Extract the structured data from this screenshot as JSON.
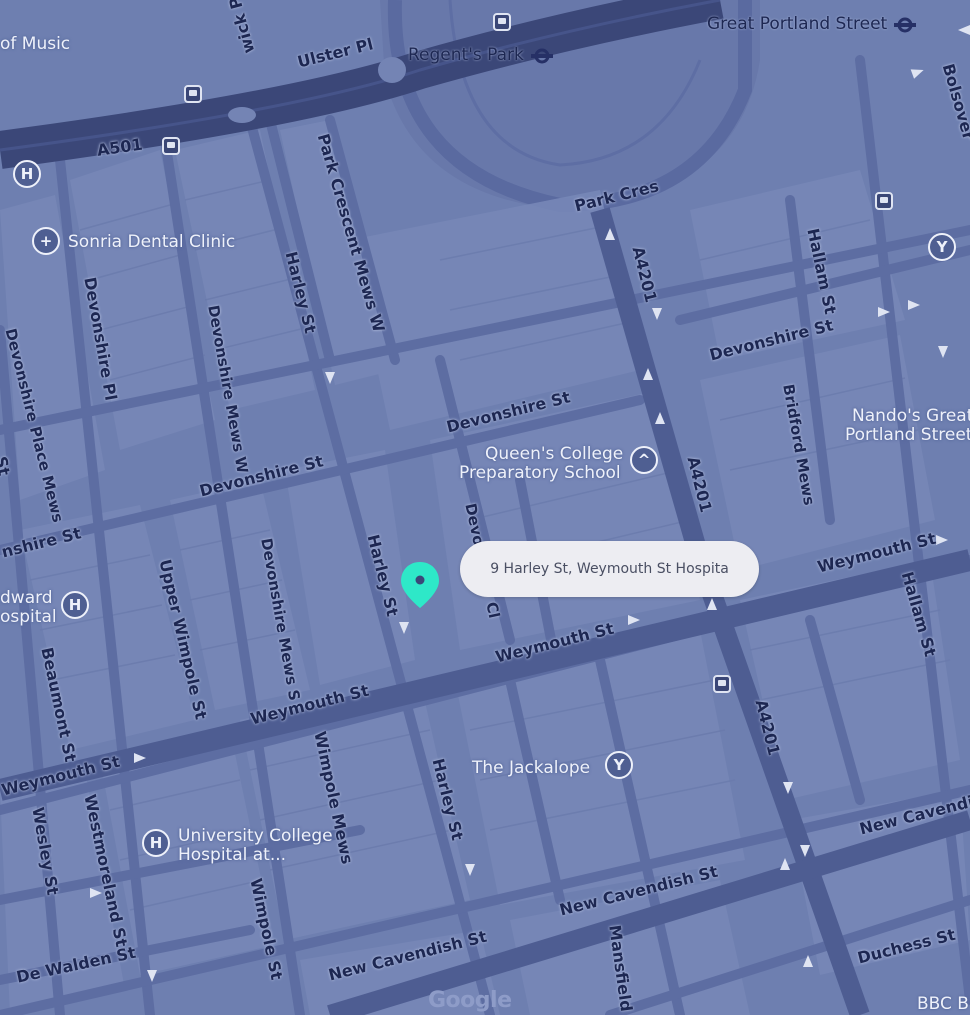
{
  "map": {
    "colors": {
      "background": "#6e7fb0",
      "block": "#7686b6",
      "road": "#5a6aa0",
      "major_road": "#4e5d92",
      "arterial": "#3b4778",
      "marker": "#2ee8c8",
      "callout_bg": "#ededf2"
    },
    "callout": {
      "text": "9 Harley St, Weymouth St Hospita"
    },
    "marker": {
      "icon": "map-pin-icon"
    },
    "provider_logo": "Google",
    "places": [
      {
        "name": "of Music"
      },
      {
        "name": "Great Portland Street"
      },
      {
        "name": "Regent's Park"
      },
      {
        "name": "Sonria Dental Clinic",
        "icon": "tooth-icon"
      },
      {
        "name": "Queen's College Preparatory School",
        "line1": "Queen's College",
        "line2": "Preparatory School",
        "icon": "school-icon"
      },
      {
        "name": "Nando's Great Portland Street",
        "line1": "Nando's Great",
        "line2": "Portland Street",
        "icon": "restaurant-icon"
      },
      {
        "name": "Edward Hospital",
        "line1": "dward",
        "line2": "ospital",
        "icon": "hospital-icon"
      },
      {
        "name": "The Jackalope",
        "icon": "bar-icon"
      },
      {
        "name": "University College Hospital at...",
        "line1": "University College",
        "line2": "Hospital at...",
        "icon": "hospital-icon"
      },
      {
        "name": "BBC B"
      }
    ],
    "streets": {
      "a501": "A501",
      "ulster_pl": "Ulster Pl",
      "wick_pl": "wick Pl",
      "park_crescent_mews_w": "Park Crescent Mews W",
      "park_cres": "Park Cres",
      "a4201_top": "A4201",
      "a4201_mid": "A4201",
      "a4201_bottom": "A4201",
      "hallam_st_top": "Hallam St",
      "hallam_st_bottom": "Hallam St",
      "bolsover": "Bolsover",
      "harley_st_top": "Harley St",
      "harley_st_mid": "Harley St",
      "harley_st_bottom": "Harley St",
      "devonshire_pl": "Devonshire Pl",
      "devonshire_place_mews": "Devonshire Place Mews",
      "devonshire_mews_w": "Devonshire Mews W",
      "devonshire_mews_s": "Devonshire Mews S",
      "devonshire_st_1": "Devonshire St",
      "devonshire_st_2": "Devonshire St",
      "devonshire_st_3": "Devonshire St",
      "devonshire_st_4": "nshire St",
      "devonshire_cl": "Devonshire Cl",
      "bridford_mews": "Bridford Mews",
      "weymouth_st_1": "Weymouth St",
      "weymouth_st_2": "Weymouth St",
      "weymouth_st_3": "Weymouth St",
      "weymouth_st_4": "Weymouth St",
      "upper_wimpole_st": "Upper Wimpole St",
      "wimpole_mews": "Wimpole Mews",
      "wimpole_st": "Wimpole St",
      "beaumont_st": "Beaumont St",
      "wesley_st": "Wesley St",
      "westmoreland_st": "Westmoreland St",
      "de_walden_st": "De Walden St",
      "new_cavendish_st_1": "New Cavendish St",
      "new_cavendish_st_2": "New Cavendish St",
      "new_cavendish_st_3": "New Cavendish",
      "mansfield_st": "Mansfield S",
      "duchess_st": "Duchess St",
      "st_fragment": "St"
    }
  }
}
